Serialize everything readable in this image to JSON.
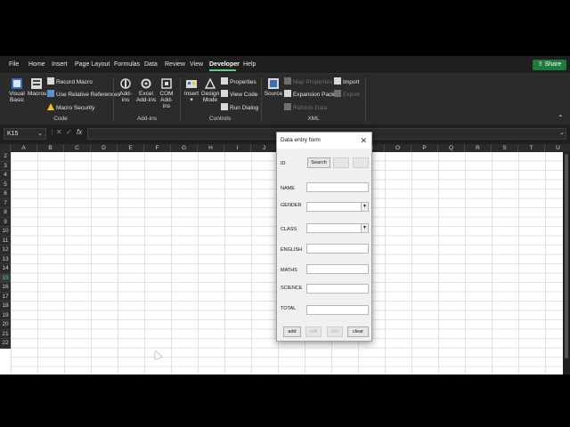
{
  "tabs": [
    "File",
    "Home",
    "Insert",
    "Page Layout",
    "Formulas",
    "Data",
    "Review",
    "View",
    "Developer",
    "Help"
  ],
  "active_tab": "Developer",
  "share_label": "Share",
  "ribbon": {
    "code": {
      "visual_basic": "Visual Basic",
      "macros": "Macros",
      "record_macro": "Record Macro",
      "use_relative": "Use Relative References",
      "macro_security": "Macro Security",
      "label": "Code"
    },
    "addins": {
      "addins": "Add-ins",
      "excel_addins": "Excel Add-ins",
      "com_addins": "COM Add-ins",
      "label": "Add-ins"
    },
    "controls": {
      "insert": "Insert",
      "design_mode": "Design Mode",
      "properties": "Properties",
      "view_code": "View Code",
      "run_dialog": "Run Dialog",
      "label": "Controls"
    },
    "xml": {
      "source": "Source",
      "map_properties": "Map Properties",
      "expansion_packs": "Expansion Packs",
      "refresh_data": "Refresh Data",
      "import": "Import",
      "export": "Export",
      "label": "XML"
    }
  },
  "formula_bar": {
    "name_box": "K15",
    "fx": "fx",
    "value": ""
  },
  "grid": {
    "columns": [
      "A",
      "B",
      "C",
      "D",
      "E",
      "F",
      "G",
      "H",
      "I",
      "J",
      "K",
      "L",
      "M",
      "N",
      "O",
      "P",
      "Q",
      "R",
      "S",
      "T",
      "U"
    ],
    "rows": [
      "2",
      "3",
      "4",
      "5",
      "6",
      "7",
      "8",
      "9",
      "10",
      "11",
      "12",
      "13",
      "14",
      "15",
      "16",
      "17",
      "18",
      "19",
      "20",
      "21",
      "22"
    ],
    "selected_row": "15"
  },
  "dialog": {
    "title": "Data entry form",
    "close": "✕",
    "labels": {
      "id": "ID",
      "name": "NAME",
      "gender": "GENDER",
      "class": "CLASS",
      "english": "ENGLISH",
      "maths": "MATHS",
      "science": "SCIENCE",
      "total": "TOTAL"
    },
    "buttons": {
      "search": "Search",
      "add": "add",
      "edit": "edit",
      "del": "del",
      "clear": "clear"
    }
  },
  "colors": {
    "accent": "#5bd085",
    "share": "#1e7a3e"
  }
}
